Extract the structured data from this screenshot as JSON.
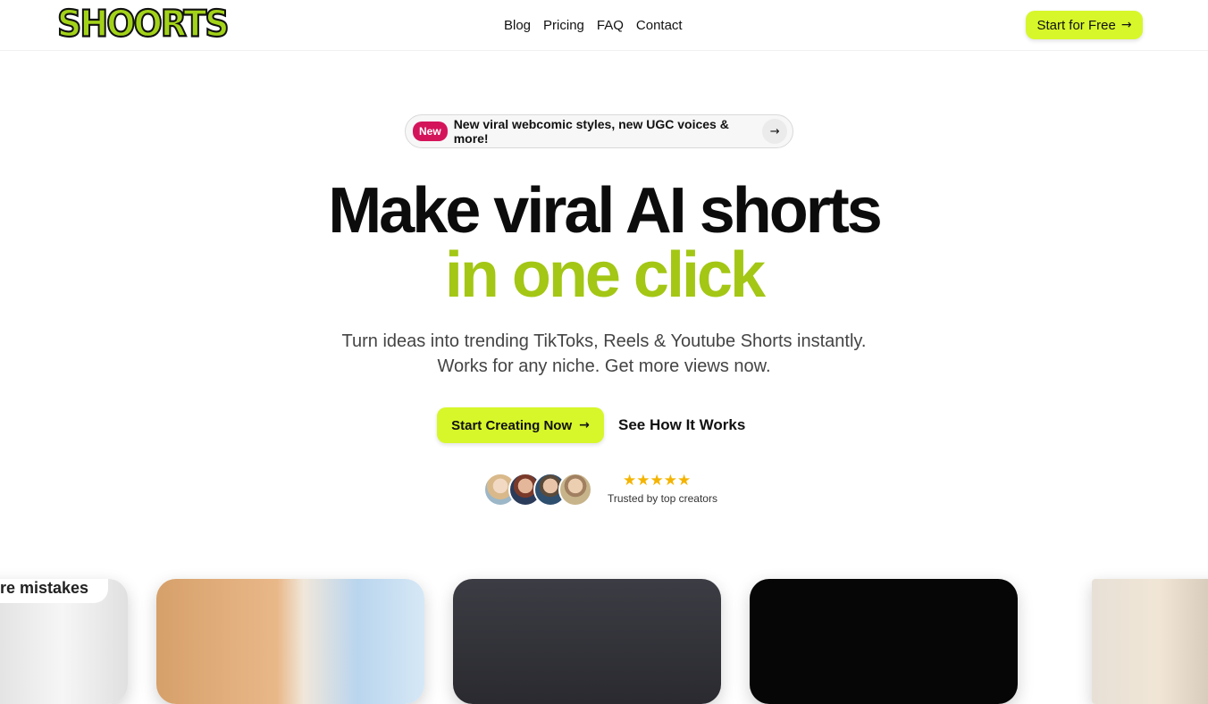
{
  "header": {
    "logo": "SHOORTS",
    "nav": [
      "Blog",
      "Pricing",
      "FAQ",
      "Contact"
    ],
    "cta": "Start for Free",
    "cta_arrow": "→"
  },
  "announcement": {
    "badge": "New",
    "text": "New viral webcomic styles, new UGC voices & more!",
    "arrow": "→"
  },
  "hero": {
    "title_line1": "Make viral AI shorts",
    "title_line2": "in one click",
    "subtitle_line1": "Turn ideas into trending TikToks, Reels & Youtube Shorts instantly.",
    "subtitle_line2": "Works for any niche. Get more views now.",
    "primary_cta": "Start Creating Now",
    "primary_arrow": "→",
    "secondary_cta": "See How It Works"
  },
  "social_proof": {
    "avatar_count": 4,
    "stars": "★★★★★",
    "rating": 5,
    "label": "Trusted by top creators"
  },
  "carousel": {
    "first_card_caption": "re mistakes"
  },
  "colors": {
    "accent": "#d7f72a",
    "accent_text": "#a3c714",
    "badge": "#d4145a",
    "star": "#f4b400"
  },
  "icons": [
    "arrow-right-icon",
    "star-icon",
    "avatar"
  ]
}
